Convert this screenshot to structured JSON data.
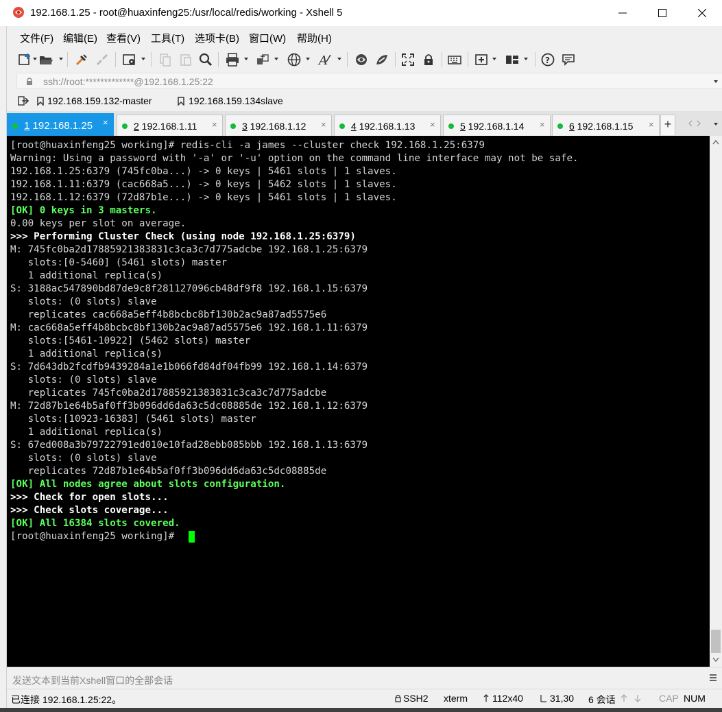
{
  "window": {
    "title": "192.168.1.25 - root@huaxinfeng25:/usr/local/redis/working - Xshell 5",
    "controls": [
      "minimize",
      "maximize",
      "close"
    ]
  },
  "menu": {
    "items": [
      {
        "label": "文件(F)"
      },
      {
        "label": "编辑(E)"
      },
      {
        "label": "查看(V)"
      },
      {
        "label": "工具(T)"
      },
      {
        "label": "选项卡(B)"
      },
      {
        "label": "窗口(W)"
      },
      {
        "label": "帮助(H)"
      }
    ]
  },
  "toolbar": {
    "icons": [
      "new-session-icon",
      "open-folder-icon",
      "connect-icon",
      "disconnect-icon",
      "properties-icon",
      "copy-icon",
      "paste-icon",
      "find-icon",
      "print-icon",
      "transfer-icon",
      "globe-icon",
      "font-icon",
      "xftp-icon",
      "xmanager-icon",
      "fullscreen-icon",
      "lock-icon",
      "keyboard-icon",
      "compose-icon",
      "layout-icon",
      "help-icon",
      "chat-icon"
    ]
  },
  "address": {
    "value": "ssh://root:*************@192.168.1.25:22"
  },
  "links": [
    {
      "label": "192.168.159.132-master"
    },
    {
      "label": "192.168.159.134slave"
    }
  ],
  "tabs": [
    {
      "num": "1",
      "label": " 192.168.1.25",
      "active": true
    },
    {
      "num": "2",
      "label": " 192.168.1.11",
      "active": false
    },
    {
      "num": "3",
      "label": " 192.168.1.12",
      "active": false
    },
    {
      "num": "4",
      "label": " 192.168.1.13",
      "active": false
    },
    {
      "num": "5",
      "label": " 192.168.1.14",
      "active": false
    },
    {
      "num": "6",
      "label": " 192.168.1.15",
      "active": false
    }
  ],
  "tab_close_glyph": "×",
  "tab_add_glyph": "+",
  "terminal": {
    "lines": [
      {
        "text": "[root@huaxinfeng25 working]# redis-cli -a james --cluster check 192.168.1.25:6379",
        "style": "normal"
      },
      {
        "text": "Warning: Using a password with '-a' or '-u' option on the command line interface may not be safe.",
        "style": "normal"
      },
      {
        "text": "192.168.1.25:6379 (745fc0ba...) -> 0 keys | 5461 slots | 1 slaves.",
        "style": "normal"
      },
      {
        "text": "192.168.1.11:6379 (cac668a5...) -> 0 keys | 5462 slots | 1 slaves.",
        "style": "normal"
      },
      {
        "text": "192.168.1.12:6379 (72d87b1e...) -> 0 keys | 5461 slots | 1 slaves.",
        "style": "normal"
      },
      {
        "text": "[OK] 0 keys in 3 masters.",
        "style": "ok"
      },
      {
        "text": "0.00 keys per slot on average.",
        "style": "normal"
      },
      {
        "text": ">>> Performing Cluster Check (using node 192.168.1.25:6379)",
        "style": "bold"
      },
      {
        "text": "M: 745fc0ba2d17885921383831c3ca3c7d775adcbe 192.168.1.25:6379",
        "style": "normal"
      },
      {
        "text": "   slots:[0-5460] (5461 slots) master",
        "style": "normal"
      },
      {
        "text": "   1 additional replica(s)",
        "style": "normal"
      },
      {
        "text": "S: 3188ac547890bd87de9c8f281127096cb48df9f8 192.168.1.15:6379",
        "style": "normal"
      },
      {
        "text": "   slots: (0 slots) slave",
        "style": "normal"
      },
      {
        "text": "   replicates cac668a5eff4b8bcbc8bf130b2ac9a87ad5575e6",
        "style": "normal"
      },
      {
        "text": "M: cac668a5eff4b8bcbc8bf130b2ac9a87ad5575e6 192.168.1.11:6379",
        "style": "normal"
      },
      {
        "text": "   slots:[5461-10922] (5462 slots) master",
        "style": "normal"
      },
      {
        "text": "   1 additional replica(s)",
        "style": "normal"
      },
      {
        "text": "S: 7d643db2fcdfb9439284a1e1b066fd84df04fb99 192.168.1.14:6379",
        "style": "normal"
      },
      {
        "text": "   slots: (0 slots) slave",
        "style": "normal"
      },
      {
        "text": "   replicates 745fc0ba2d17885921383831c3ca3c7d775adcbe",
        "style": "normal"
      },
      {
        "text": "M: 72d87b1e64b5af0ff3b096dd6da63c5dc08885de 192.168.1.12:6379",
        "style": "normal"
      },
      {
        "text": "   slots:[10923-16383] (5461 slots) master",
        "style": "normal"
      },
      {
        "text": "   1 additional replica(s)",
        "style": "normal"
      },
      {
        "text": "S: 67ed008a3b79722791ed010e10fad28ebb085bbb 192.168.1.13:6379",
        "style": "normal"
      },
      {
        "text": "   slots: (0 slots) slave",
        "style": "normal"
      },
      {
        "text": "   replicates 72d87b1e64b5af0ff3b096dd6da63c5dc08885de",
        "style": "normal"
      },
      {
        "text": "[OK] All nodes agree about slots configuration.",
        "style": "ok"
      },
      {
        "text": ">>> Check for open slots...",
        "style": "bold"
      },
      {
        "text": ">>> Check slots coverage...",
        "style": "bold"
      },
      {
        "text": "[OK] All 16384 slots covered.",
        "style": "ok"
      },
      {
        "text": "[root@huaxinfeng25 working]# ",
        "style": "normal"
      }
    ]
  },
  "compose": {
    "placeholder": "发送文本到当前Xshell窗口的全部会话"
  },
  "status": {
    "connection": "已连接 192.168.1.25:22。",
    "protocol": "SSH2",
    "terminal_type": "xterm",
    "size": "112x40",
    "cursor_pos": "31,30",
    "sessions": "6 会话",
    "caps": "CAP",
    "num": "NUM"
  },
  "colors": {
    "tab_active": "#1797e6",
    "tab_dot": "#17b83b",
    "terminal_bg": "#000000",
    "terminal_fg": "#d4d4d4",
    "terminal_ok": "#5bff5b",
    "cursor": "#00ff00"
  }
}
